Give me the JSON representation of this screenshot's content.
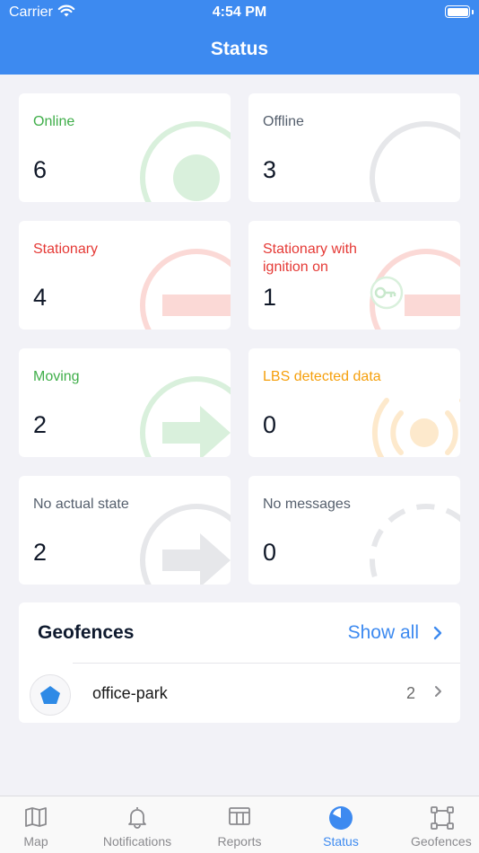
{
  "status_bar": {
    "carrier": "Carrier",
    "time": "4:54 PM"
  },
  "header": {
    "title": "Status"
  },
  "cards": [
    {
      "label": "Online",
      "count": "6",
      "color": "#3fae49"
    },
    {
      "label": "Offline",
      "count": "3",
      "color": "#555f6d"
    },
    {
      "label": "Stationary",
      "count": "4",
      "color": "#e53935"
    },
    {
      "label": "Stationary with ignition on",
      "count": "1",
      "color": "#e53935"
    },
    {
      "label": "Moving",
      "count": "2",
      "color": "#3fae49"
    },
    {
      "label": "LBS detected data",
      "count": "0",
      "color": "#f59f0b"
    },
    {
      "label": "No actual state",
      "count": "2",
      "color": "#555f6d"
    },
    {
      "label": "No messages",
      "count": "0",
      "color": "#555f6d"
    }
  ],
  "geofences": {
    "title": "Geofences",
    "show_all": "Show all",
    "items": [
      {
        "name": "office-park",
        "count": "2",
        "icon": "pentagon-icon"
      }
    ]
  },
  "tabbar": {
    "tabs": [
      {
        "label": "Map",
        "icon": "map-icon"
      },
      {
        "label": "Notifications",
        "icon": "bell-icon"
      },
      {
        "label": "Reports",
        "icon": "table-icon"
      },
      {
        "label": "Status",
        "icon": "pie-chart-icon",
        "active": true
      },
      {
        "label": "Geofences",
        "icon": "geofence-icon"
      }
    ]
  },
  "colors": {
    "accent": "#3d8af0",
    "online": "#3fae49",
    "stationary": "#e53935",
    "lbs": "#f59f0b"
  }
}
